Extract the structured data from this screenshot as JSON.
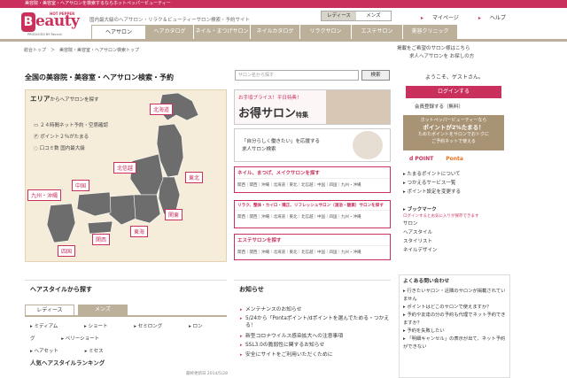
{
  "topbar": {
    "text": "美容院・美容室・ヘアサロンを検索するならホットペッパービューティー"
  },
  "header": {
    "logo_hp": "HOT PEPPER",
    "logo_beauty": "eauty",
    "logo_b": "B",
    "logo_sub": "PRODUCED BY Recruit",
    "tagline": "国内最大級のヘアサロン・リラク＆ビューティーサロン検索・予約サイト",
    "segment": [
      "レディース",
      "メンズ"
    ],
    "links": [
      "マイページ",
      "ヘルプ"
    ]
  },
  "nav": [
    "ヘアサロン",
    "ヘアカタログ",
    "ネイル・まつげサロン",
    "ネイルカタログ",
    "リラクサロン",
    "エステサロン",
    "美容クリニック"
  ],
  "breadcrumb": "総合トップ　＞　美容院・美容室・ヘアサロン検索トップ",
  "promo_right": [
    "掲載をご希望のサロン様はこちら",
    "求人ヘアサロンを お探しの方"
  ],
  "page_title": "全国の美容院・美容室・ヘアサロン検索・予約",
  "search": {
    "placeholder": "サロン名から探す",
    "button": "検索"
  },
  "area": {
    "title": "エリア",
    "title_suffix": "からヘアサロンを探す",
    "features": [
      "２４時間ネット予約・空席確認",
      "ポイント２％がたまる",
      "口コミ数 国内最大級"
    ],
    "regions": [
      "北海道",
      "東北",
      "北信越",
      "関東",
      "中国",
      "九州・沖縄",
      "東海",
      "関西",
      "四国"
    ]
  },
  "banners": {
    "b1_top": "お手頃プライス！平日特典！",
    "b1_main": "お得サロン",
    "b1_suffix": "特集",
    "b2_line1": "「自分らしく働きたい」を応援する",
    "b2_line2": "求人サロン検索"
  },
  "linkboxes": [
    {
      "title": "ネイル、まつげ、メイクサロンを探す",
      "links": "関西｜関西｜沖縄｜北海道｜東北｜北信越｜中国｜四国｜九州・沖縄"
    },
    {
      "title": "リラク、整体・カイロ・矯正、リフレッシュサロン（温浴・酸素）サロンを探す",
      "links": "関西｜関西｜沖縄｜北海道｜東北｜北信越｜中国｜四国｜九州・沖縄"
    },
    {
      "title": "エステサロンを探す",
      "links": "関西｜関西｜沖縄｜北海道｜東北｜北信越｜中国｜四国｜九州・沖縄"
    }
  ],
  "sidebar": {
    "welcome": "ようこそ、ゲストさん。",
    "login": "ログインする",
    "register": "会員登録する（無料）",
    "point_lines": [
      "ホットペッパービューティーなら",
      "ポイントが2%たまる！",
      "ためたポイントをサロンでおトクに",
      "ご予約ネットで使える"
    ],
    "dpoint": "d POINT",
    "ponta": "Ponta",
    "links": [
      "たまるポイントについて",
      "つかえるサービス一覧",
      "ポイント設定を変更する"
    ],
    "bookmark_title": "ブックマーク",
    "bookmark_note": "ログインするとお気に入りが保存できます",
    "bookmarks": [
      "サロン",
      "ヘアスタイル",
      "スタイリスト",
      "ネイルデザイン"
    ]
  },
  "faq": {
    "title": "よくある問い合わせ",
    "items": [
      "行きたいサロン・近隣のサロンが掲載されていません",
      "ポイントはどこのサロンで使えますか？",
      "予約や友達の分の予約も代理でネット予約できますか？",
      "予約を失敗したい",
      "「明細キャンセル」の表示が出て、ネット予約ができない"
    ]
  },
  "hairstyle": {
    "title": "ヘアスタイルから探す",
    "tabs": [
      "レディース",
      "メンズ"
    ],
    "styles": [
      "ミディアム",
      "ショート",
      "セミロング",
      "ロング",
      "ベリーショート",
      "ヘアセット",
      "ミセス"
    ],
    "ranking_title": "人気ヘアスタイルランキング",
    "ranking_date": "最終更新日 2014/5/28"
  },
  "news": {
    "title": "お知らせ",
    "items": [
      "メンテナンスのお知らせ",
      "5/24から「Pontaポイント/dポイントを選んでためる・つかえる！",
      "新型コロナウイルス感染拡大への注意事項",
      "SSL3.0の脆弱性に関するお知らせ",
      "安全にサイトをご利用いただくために"
    ]
  }
}
